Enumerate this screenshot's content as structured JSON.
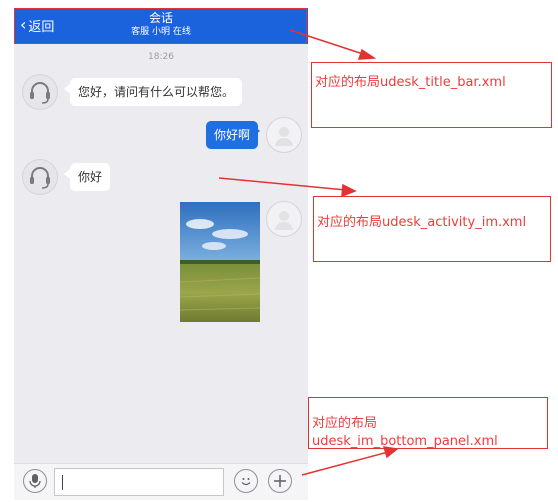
{
  "title_bar": {
    "back_label": "返回",
    "title": "会话",
    "subtitle": "客服 小明 在线"
  },
  "chat": {
    "timestamp": "18:26",
    "messages": [
      {
        "side": "left",
        "text": "您好，请问有什么可以帮您。"
      },
      {
        "side": "right",
        "text": "你好啊"
      },
      {
        "side": "left",
        "text": "你好"
      }
    ],
    "image_message": {
      "side": "right",
      "image": "field-landscape-photo"
    }
  },
  "bottom_panel": {
    "input_value": "",
    "icons": [
      "microphone-icon",
      "emoji-icon",
      "plus-icon"
    ]
  },
  "annotations": [
    {
      "text": "对应的布局udesk_title_bar.xml"
    },
    {
      "text": "对应的布局udesk_activity_im.xml"
    },
    {
      "line1": "对应的布局",
      "line2": "udesk_im_bottom_panel.xml"
    }
  ],
  "colors": {
    "title_bar": "#1a63dd",
    "bubble_right": "#1f6fe0",
    "annotation_red": "#e23333",
    "chat_bg": "#ececf0"
  }
}
